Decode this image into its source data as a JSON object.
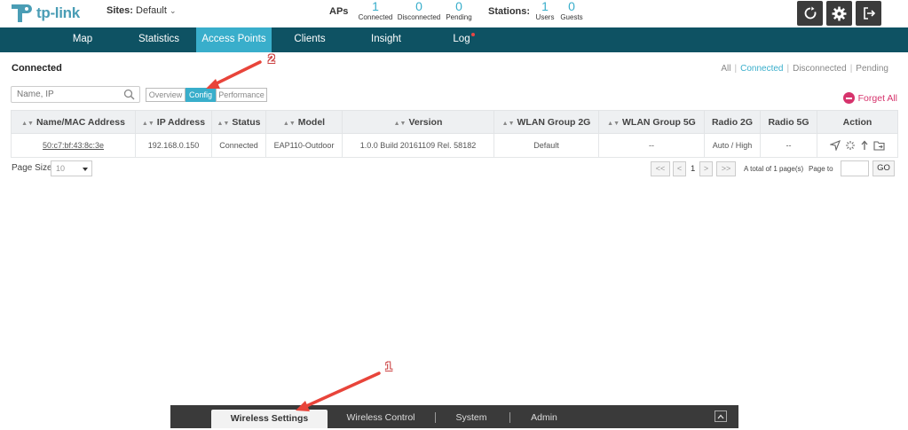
{
  "header": {
    "brand": "tp-link",
    "sites_label": "Sites:",
    "sites_value": "Default",
    "aps_label": "APs",
    "aps": [
      {
        "count": "1",
        "label": "Connected"
      },
      {
        "count": "0",
        "label": "Disconnected"
      },
      {
        "count": "0",
        "label": "Pending"
      }
    ],
    "stations_label": "Stations:",
    "stations": [
      {
        "count": "1",
        "label": "Users"
      },
      {
        "count": "0",
        "label": "Guests"
      }
    ]
  },
  "nav": {
    "items": [
      "Map",
      "Statistics",
      "Access Points",
      "Clients",
      "Insight",
      "Log"
    ],
    "active": "Access Points"
  },
  "page": {
    "title": "Connected",
    "filters": [
      "All",
      "Connected",
      "Disconnected",
      "Pending"
    ],
    "active_filter": "Connected",
    "search_placeholder": "Name, IP",
    "tabs": [
      "Overview",
      "Config",
      "Performance"
    ],
    "active_tab": "Config",
    "forget_all": "Forget All"
  },
  "table": {
    "columns": [
      "Name/MAC Address",
      "IP Address",
      "Status",
      "Model",
      "Version",
      "WLAN Group 2G",
      "WLAN Group 5G",
      "Radio 2G",
      "Radio 5G",
      "Action"
    ],
    "rows": [
      {
        "mac": "50:c7:bf:43:8c:3e",
        "ip": "192.168.0.150",
        "status": "Connected",
        "model": "EAP110-Outdoor",
        "version": "1.0.0 Build 20161109 Rel. 58182",
        "wlan2g": "Default",
        "wlan5g": "--",
        "radio2g": "Auto / High",
        "radio5g": "--"
      }
    ]
  },
  "pagination": {
    "page_size_label": "Page Size",
    "page_size": "10",
    "first": "<<",
    "prev": "<",
    "current": "1",
    "next": ">",
    "last": ">>",
    "total": "A total of 1 page(s)",
    "page_to": "Page to",
    "go": "GO"
  },
  "bottom_bar": {
    "items": [
      "Wireless Settings",
      "Wireless Control",
      "System",
      "Admin"
    ],
    "active": "Wireless Settings"
  },
  "annotations": {
    "step1": "1",
    "step2": "2",
    "arrow_color": "#e8443a"
  },
  "colors": {
    "accent": "#39aecb",
    "nav_bg": "#0e5263",
    "connected": "#4caf50",
    "forget": "#d6336c"
  }
}
